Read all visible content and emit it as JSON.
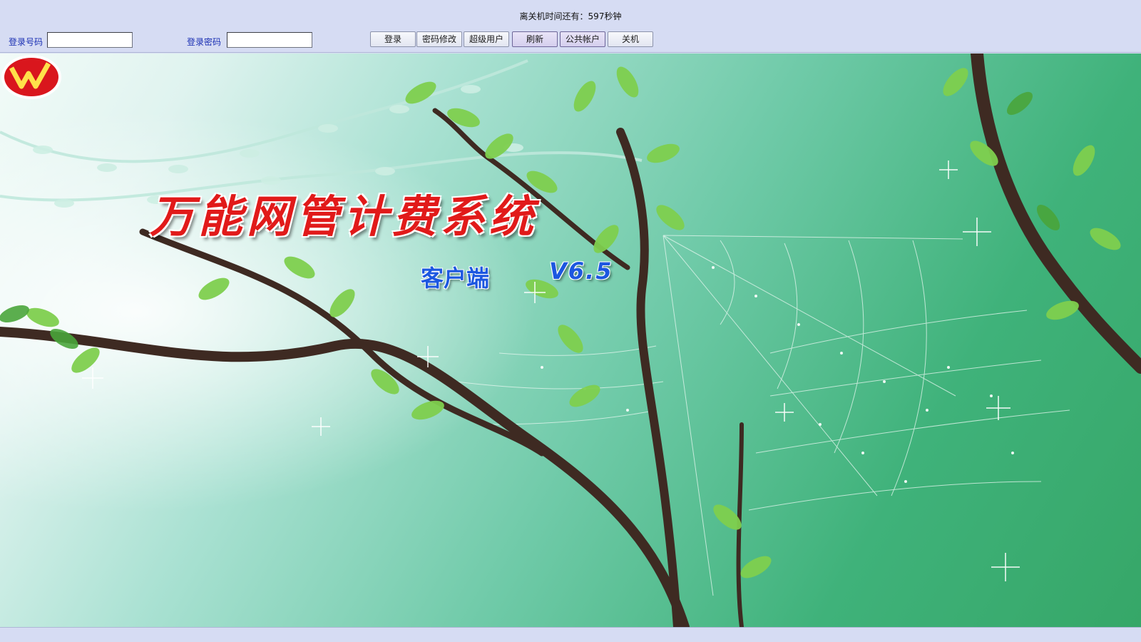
{
  "header": {
    "countdown_text": "离关机时间还有：597秒钟"
  },
  "login": {
    "account_label": "登录号码",
    "account_value": "",
    "password_label": "登录密码",
    "password_value": ""
  },
  "toolbar": {
    "buttons": [
      {
        "label": "登录"
      },
      {
        "label": "密码修改"
      },
      {
        "label": "超级用户"
      },
      {
        "label": "刷新"
      },
      {
        "label": "公共帐户"
      },
      {
        "label": "关机"
      }
    ]
  },
  "banner": {
    "title": "万能网管计费系统",
    "client_label": "客户端",
    "version": "V6.5",
    "logo_letter": "W",
    "colors": {
      "title": "#e11a1a",
      "subtitle": "#1c57e0",
      "background": "#3fb27a"
    }
  }
}
